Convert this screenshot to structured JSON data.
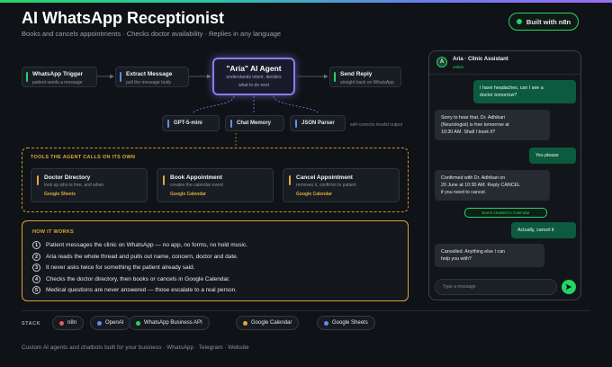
{
  "header": {
    "title": "AI WhatsApp Receptionist",
    "subtitle": "Books and cancels appointments · Checks doctor availability · Replies in any language",
    "badge": "Built with n8n"
  },
  "flow": {
    "trigger": {
      "title": "WhatsApp Trigger",
      "sub": "patient sends a message"
    },
    "extract": {
      "title": "Extract Message",
      "sub": "pull the message body"
    },
    "agent": {
      "title": "\"Aria\" AI Agent",
      "sub1": "understands intent, decides",
      "sub2": "what to do next"
    },
    "reply": {
      "title": "Send Reply",
      "sub": "straight back on WhatsApp"
    },
    "model": "GPT-5-mini",
    "memory": "Chat Memory",
    "parser": "JSON Parser",
    "parser_note": "self-corrects invalid output"
  },
  "tools": {
    "heading": "TOOLS THE AGENT CALLS ON ITS OWN",
    "items": [
      {
        "title": "Doctor Directory",
        "sub": "look up who is free, and when",
        "tag": "Google Sheets"
      },
      {
        "title": "Book Appointment",
        "sub": "creates the calendar event",
        "tag": "Google Calendar"
      },
      {
        "title": "Cancel Appointment",
        "sub": "removes it, confirms to patient",
        "tag": "Google Calendar"
      }
    ]
  },
  "how": {
    "heading": "HOW IT WORKS",
    "steps": [
      {
        "n": "1",
        "text": "Patient messages the clinic on WhatsApp — no app, no forms, no hold music."
      },
      {
        "n": "2",
        "text": "Aria reads the whole thread and pulls out name, concern, doctor and date."
      },
      {
        "n": "3",
        "text": "It never asks twice for something the patient already said."
      },
      {
        "n": "4",
        "text": "Checks the doctor directory, then books or cancels in Google Calendar."
      },
      {
        "n": "5",
        "text": "Medical questions are never answered — those escalate to a real person."
      }
    ]
  },
  "stack": {
    "label": "STACK",
    "items": [
      {
        "name": "n8n",
        "color": "#e8556d"
      },
      {
        "name": "OpenAI",
        "color": "#5b8cf0"
      },
      {
        "name": "WhatsApp Business API",
        "color": "#25d366"
      },
      {
        "name": "Google Calendar",
        "color": "#e0a93a"
      },
      {
        "name": "Google Sheets",
        "color": "#5b8cf0"
      }
    ]
  },
  "footer": "Custom AI agents and chatbots built for your business · WhatsApp · Telegram · Website",
  "chat": {
    "avatar": "A",
    "name": "Aria · Clinic Assistant",
    "status": "online",
    "messages": [
      {
        "side": "out",
        "lines": [
          "I have headaches, can I see a",
          "doctor tomorrow?"
        ]
      },
      {
        "side": "in",
        "lines": [
          "Sorry to hear that. Dr. Adhikari",
          "(Neurologist) is free tomorrow at",
          "10:30 AM. Shall I book it?"
        ]
      },
      {
        "side": "out",
        "lines": [
          "Yes please"
        ]
      },
      {
        "side": "in",
        "lines": [
          "Confirmed with Dr. Adhikari on",
          "20 June at 10:30 AM. Reply CANCEL",
          "if you need to cancel."
        ]
      },
      {
        "side": "out",
        "lines": [
          "Actually, cancel it"
        ]
      },
      {
        "side": "in",
        "lines": [
          "Cancelled. Anything else I can",
          "help you with?"
        ]
      }
    ],
    "event": "Event created in Calendar",
    "input_placeholder": "Type a message",
    "send_icon": "send-icon"
  },
  "colors": {
    "accent_green": "#25d366",
    "agent_purple": "#8a7cf0",
    "tools_amber": "#e0a93a",
    "tool_blue": "#6a8cf0"
  }
}
